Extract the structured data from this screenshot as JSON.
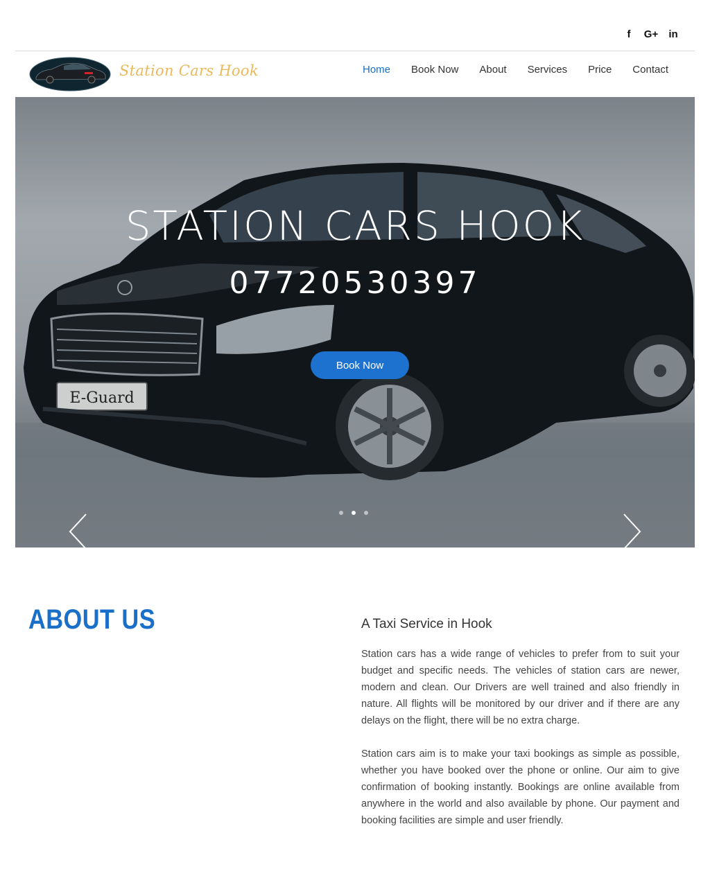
{
  "social": {
    "facebook": "f",
    "google_plus": "G+",
    "linkedin": "in"
  },
  "header": {
    "brand": "Station Cars Hook",
    "nav": [
      {
        "label": "Home",
        "active": true
      },
      {
        "label": "Book Now",
        "active": false
      },
      {
        "label": "About",
        "active": false
      },
      {
        "label": "Services",
        "active": false
      },
      {
        "label": "Price",
        "active": false
      },
      {
        "label": "Contact",
        "active": false
      }
    ]
  },
  "hero": {
    "title": "STATION CARS HOOK",
    "phone": "07720530397",
    "button_label": "Book Now",
    "plate_text": "E-Guard",
    "slides": 3,
    "active_slide": 1
  },
  "about": {
    "title": "ABOUT US",
    "subtitle": "A Taxi Service in Hook",
    "paragraph1": "Station cars has a wide range of vehicles to prefer from to suit your budget and specific needs. The vehicles of station cars are newer, modern and clean. Our Drivers are well trained and also friendly in nature. All flights will be monitored by our driver and if there are any delays on the flight, there will be no extra charge.",
    "paragraph2": "Station cars aim is to make your taxi bookings as simple as possible, whether you have booked over the phone or online. Our aim to give confirmation of booking instantly. Bookings are online available from anywhere in the world and also available by phone. Our payment and booking facilities are simple and user friendly."
  },
  "colors": {
    "accent": "#1a6fc9",
    "button": "#1d72d0",
    "brand_gold": "#e9b95a"
  }
}
